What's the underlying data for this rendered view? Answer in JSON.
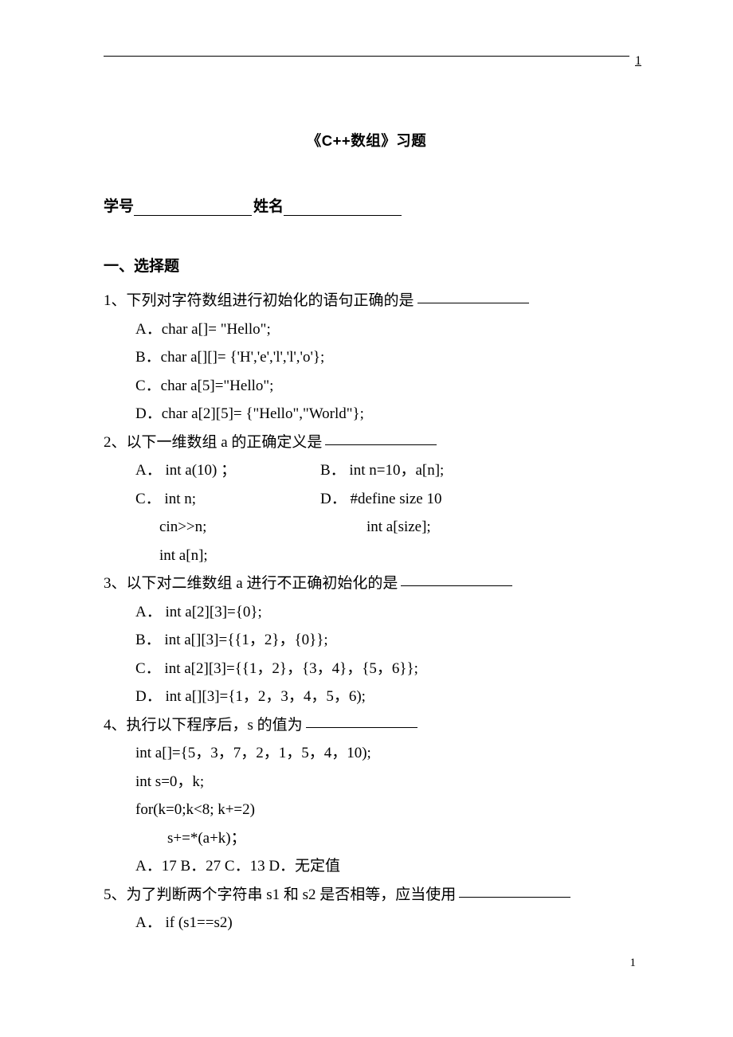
{
  "header": {
    "pageMark": "1"
  },
  "footer": {
    "pageNum": "1"
  },
  "title": "《C++数组》习题",
  "info": {
    "idLabel": "学号",
    "nameLabel": "姓名"
  },
  "section1": {
    "heading": "一、选择题"
  },
  "q1": {
    "stem": "1、下列对字符数组进行初始化的语句正确的是",
    "A": "A．char a[]= \"Hello\";",
    "B": "B．char a[][]= {'H','e','l','l','o'};",
    "C": "C．char a[5]=\"Hello\";",
    "D": "D．char a[2][5]= {\"Hello\",\"World\"};"
  },
  "q2": {
    "stem": "2、以下一维数组 a 的正确定义是",
    "row1a": "A． int a(10) ；",
    "row1b": "B． int n=10，a[n];",
    "row2a": "C． int n;",
    "row2b": "D． #define size 10",
    "row3a": "cin>>n;",
    "row3b": "int a[size];",
    "row4a": "int a[n];"
  },
  "q3": {
    "stem": "3、以下对二维数组 a 进行不正确初始化的是",
    "A": "A． int a[2][3]={0};",
    "B": "B． int a[][3]={{1，2}，{0}};",
    "C": "C． int a[2][3]={{1，2}，{3，4}，{5，6}};",
    "D": "D． int a[][3]={1，2，3，4，5，6);"
  },
  "q4": {
    "stem": "4、执行以下程序后，s 的值为",
    "l1": "int a[]={5，3，7，2，1，5，4，10);",
    "l2": "int s=0，k;",
    "l3": "for(k=0;k<8; k+=2)",
    "l4": "s+=*(a+k)；",
    "opts": "A．17    B．27    C．13       D．无定值"
  },
  "q5": {
    "stem": "5、为了判断两个字符串 s1 和 s2 是否相等，应当使用",
    "A": "A． if (s1==s2)"
  }
}
